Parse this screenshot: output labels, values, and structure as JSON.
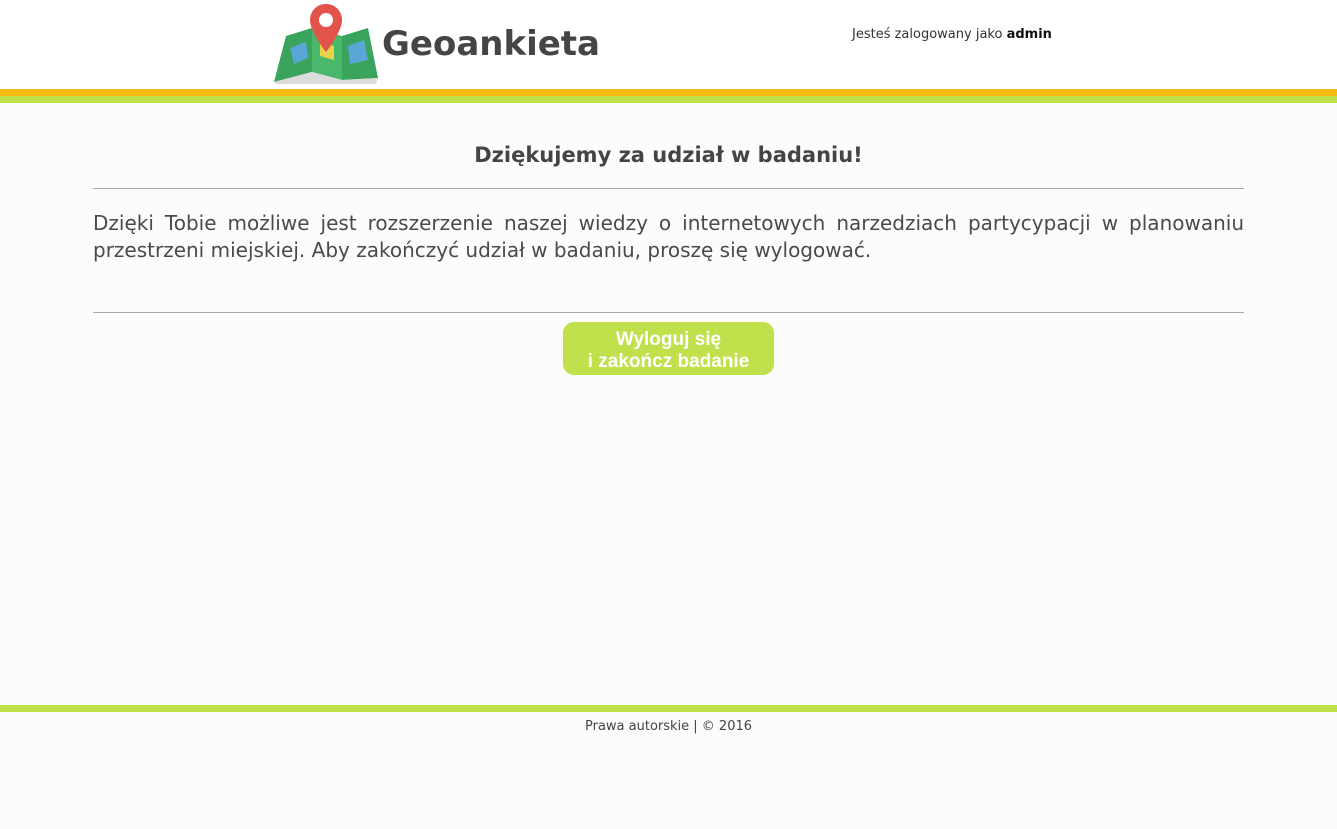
{
  "header": {
    "brand": "Geoankieta",
    "user_prefix": "Jesteś zalogowany jako",
    "user_name": "admin"
  },
  "colors": {
    "accent_orange": "#f6b814",
    "accent_green": "#c0e04c",
    "text": "#444444"
  },
  "main": {
    "title": "Dziękujemy za udział w badaniu!",
    "message": "Dzięki Tobie możliwe jest rozszerzenie naszej wiedzy o internetowych narzedziach partycypacji w planowaniu przestrzeni miejskiej. Aby zakończyć udział w badaniu, proszę się wylogować.",
    "logout_line1": "Wyloguj się",
    "logout_line2": "i zakończ badanie"
  },
  "footer": {
    "copyright": "Prawa autorskie | © 2016"
  }
}
